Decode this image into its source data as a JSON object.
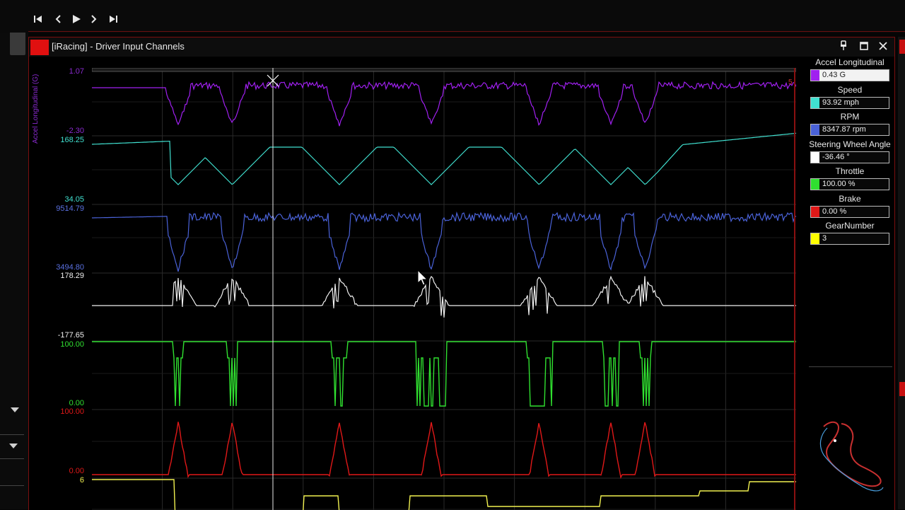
{
  "window": {
    "title": "[iRacing] - Driver Input Channels"
  },
  "toolbar": {
    "first": "first-icon",
    "prev": "prev-icon",
    "play": "play-icon",
    "next": "next-icon",
    "last": "last-icon"
  },
  "axes": {
    "accel_max": "1.07",
    "accel_min": "-2.30",
    "accel_title": "Accel Longitudinal (G)",
    "speed_max": "168.25",
    "speed_min": "34.05",
    "rpm_max": "9514.79",
    "rpm_min": "3494.80",
    "steer_max": "178.29",
    "steer_min": "-177.65",
    "throttle_max": "100.00",
    "throttle_min": "0.00",
    "brake_max": "100.00",
    "brake_min": "0.00",
    "gear_max": "6",
    "corner_mark": "5"
  },
  "colors": {
    "accel": "#a020f0",
    "speed": "#40e0d0",
    "rpm": "#4a62d8",
    "steer": "#f0f0f0",
    "throttle": "#30e030",
    "brake": "#e01818",
    "gear": "#f0f050",
    "grid": "#2a2a2a"
  },
  "legend": [
    {
      "name": "Accel Longitudinal",
      "value": "0.43 G",
      "color": "#a020f0",
      "selected": true
    },
    {
      "name": "Speed",
      "value": "93.92 mph",
      "color": "#40e0d0"
    },
    {
      "name": "RPM",
      "value": "8347.87 rpm",
      "color": "#4a62d8"
    },
    {
      "name": "Steering Wheel Angle",
      "value": "-36.46 °",
      "color": "#ffffff"
    },
    {
      "name": "Throttle",
      "value": "100.00 %",
      "color": "#30e030"
    },
    {
      "name": "Brake",
      "value": "0.00 %",
      "color": "#e01818"
    },
    {
      "name": "GearNumber",
      "value": "3",
      "color": "#ffff00"
    }
  ]
}
